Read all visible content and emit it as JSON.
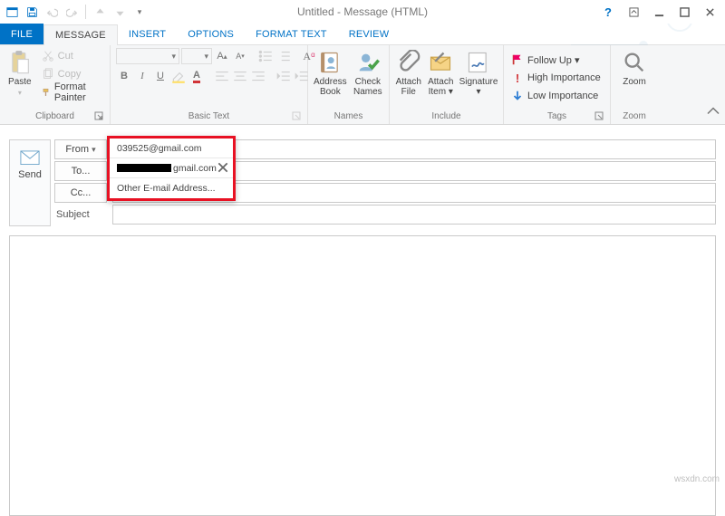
{
  "window": {
    "title": "Untitled - Message (HTML)"
  },
  "tabs": {
    "file": "FILE",
    "message": "MESSAGE",
    "insert": "INSERT",
    "options": "OPTIONS",
    "format_text": "FORMAT TEXT",
    "review": "REVIEW"
  },
  "ribbon": {
    "clipboard": {
      "paste": "Paste",
      "cut": "Cut",
      "copy": "Copy",
      "format_painter": "Format Painter",
      "group": "Clipboard"
    },
    "basic_text": {
      "group": "Basic Text"
    },
    "names": {
      "address_book": "Address\nBook",
      "check_names": "Check\nNames",
      "group": "Names"
    },
    "include": {
      "attach_file": "Attach\nFile",
      "attach_item": "Attach\nItem ▾",
      "signature": "Signature\n▾",
      "group": "Include"
    },
    "tags": {
      "follow_up": "Follow Up ▾",
      "high": "High Importance",
      "low": "Low Importance",
      "group": "Tags"
    },
    "zoom": {
      "zoom": "Zoom",
      "group": "Zoom"
    }
  },
  "compose": {
    "send": "Send",
    "from_btn": "From",
    "from_value": "039525@gmail.com",
    "to_btn": "To...",
    "cc_btn": "Cc...",
    "subject_label": "Subject"
  },
  "from_menu": {
    "item1": "039525@gmail.com",
    "item2_suffix": "gmail.com",
    "item3": "Other E-mail Address..."
  },
  "watermark": "wsxdn.com"
}
